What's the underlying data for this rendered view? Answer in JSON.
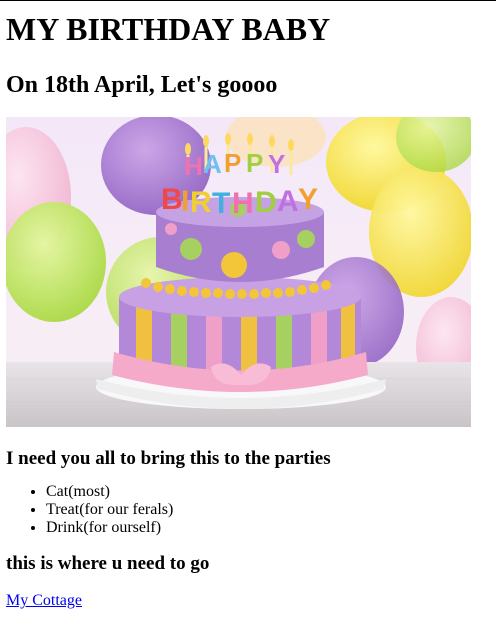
{
  "heading": "MY BIRTHDAY BABY",
  "subheading": "On 18th April, Let's goooo",
  "image": {
    "description_alt": "Birthday cake",
    "cake_letters_top": "HAPPY",
    "cake_letters_bottom": "BIRTHDAY"
  },
  "bring_heading": "I need you all to bring this to the parties",
  "bring_items": [
    "Cat(most)",
    "Treat(for our ferals)",
    "Drink(for ourself)"
  ],
  "where_heading": "this is where u need to go",
  "link_text": "My Cottage",
  "colors": {
    "link": "#0000ee",
    "text": "#000000",
    "background": "#ffffff"
  }
}
